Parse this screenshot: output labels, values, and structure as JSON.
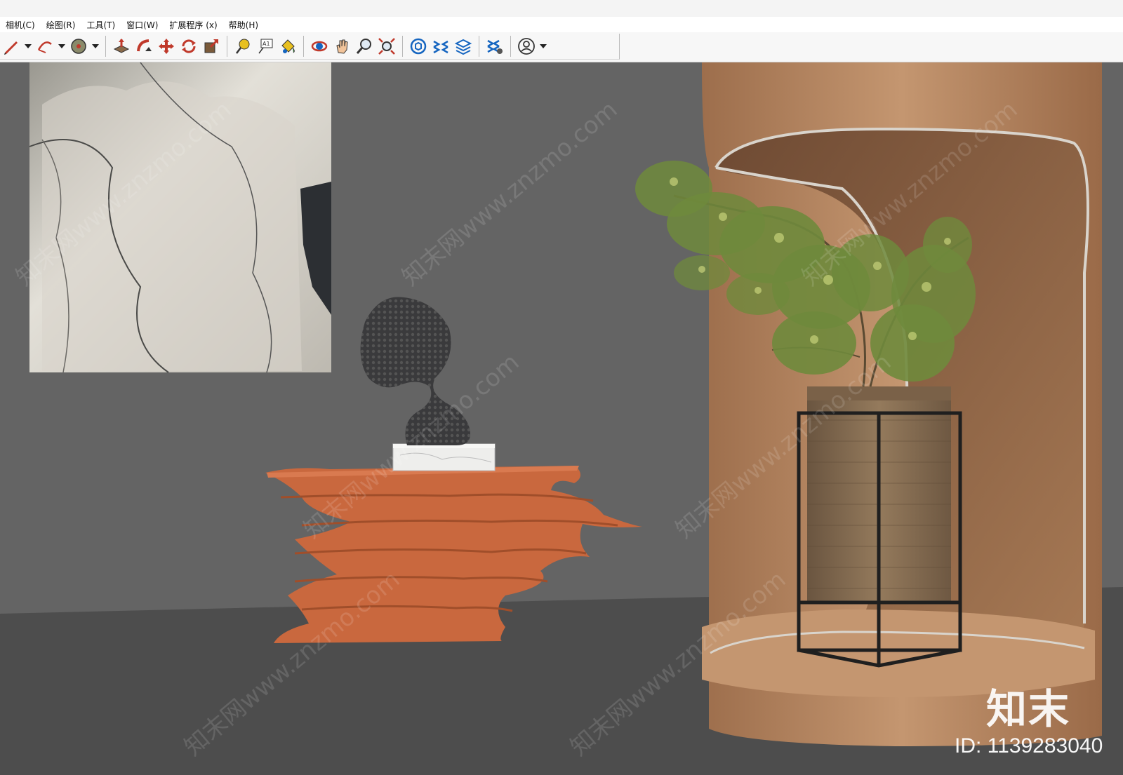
{
  "menu": {
    "items": [
      {
        "name": "menu-camera",
        "label": "相机(C)"
      },
      {
        "name": "menu-draw",
        "label": "绘图(R)"
      },
      {
        "name": "menu-tools",
        "label": "工具(T)"
      },
      {
        "name": "menu-window",
        "label": "窗口(W)"
      },
      {
        "name": "menu-extensions",
        "label": "扩展程序 (x)"
      },
      {
        "name": "menu-help",
        "label": "帮助(H)"
      }
    ]
  },
  "toolbar": {
    "icons": [
      "pencil-icon",
      "arc-icon",
      "circle-icon",
      "pushpull-icon",
      "followme-icon",
      "move-icon",
      "rotate-icon",
      "scale-icon",
      "tape-measure-icon",
      "text-icon",
      "paint-bucket-icon",
      "orbit-icon",
      "pan-icon",
      "zoom-icon",
      "zoom-extents-icon",
      "3d-warehouse-icon",
      "extension-warehouse-icon",
      "layout-icon",
      "extension-manager-icon",
      "user-account-icon"
    ]
  },
  "watermark": {
    "logo": "知末",
    "id_text": "ID: 1139283040",
    "pattern_text": "知末网www.znzmo.com"
  },
  "colors": {
    "wall": "#646464",
    "floor": "#4d4d4d",
    "console_orange": "#c9683e",
    "niche_tan": "#b98a62",
    "plant_green": "#6f8a3c",
    "planter_wood": "#8a7358"
  }
}
